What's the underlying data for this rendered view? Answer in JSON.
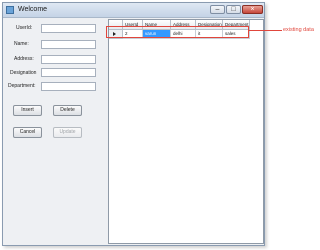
{
  "window": {
    "title": "Welcome",
    "controls": {
      "minimize": "–",
      "maximize": "□",
      "close": "×"
    }
  },
  "form": {
    "labels": {
      "userid": "UserId:",
      "name": "Name:",
      "address": "Address:",
      "designation": "Designation",
      "department": "Department:"
    },
    "fields": {
      "userid": "",
      "name": "",
      "address": "",
      "designation": "",
      "department": ""
    },
    "buttons": {
      "insert": "Insert",
      "delete": "Delete",
      "cancel": "Cancel",
      "update": "Update"
    }
  },
  "grid": {
    "columns": [
      "UserId",
      "Name",
      "Address",
      "Designation",
      "Department"
    ],
    "rows": [
      [
        "2",
        "varun",
        "delhi",
        "it",
        "sales"
      ]
    ]
  },
  "annotation": {
    "label": "existing data",
    "color": "#e0463c"
  },
  "colors": {
    "selection": "#3399ff"
  }
}
